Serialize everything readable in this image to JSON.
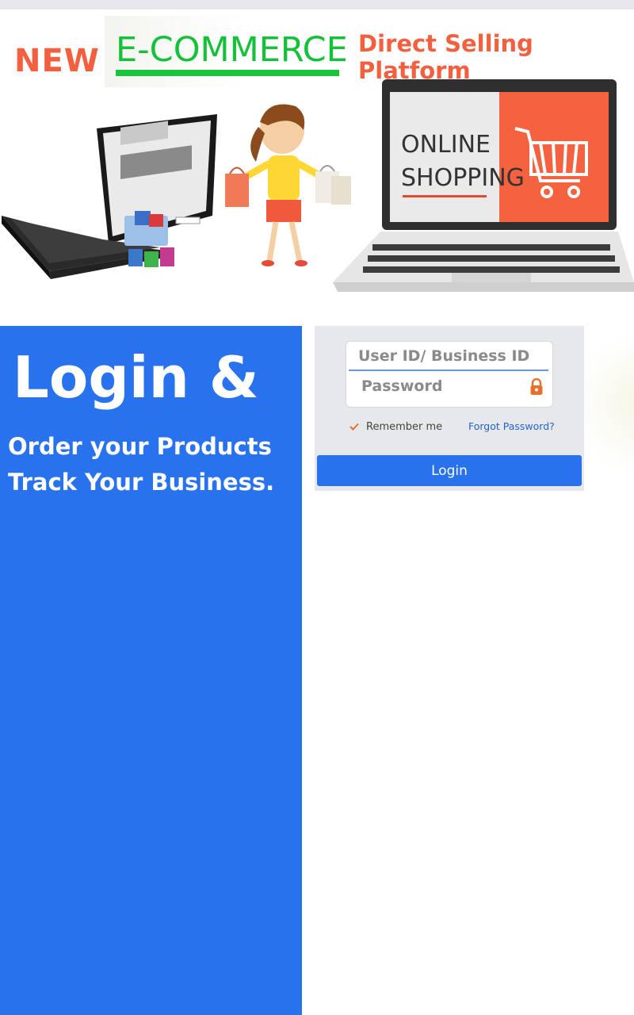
{
  "banner": {
    "new_label": "NEW",
    "ecommerce_label": "E-COMMERCE",
    "direct_selling_label": "Direct Selling Platform",
    "laptop_screen_line1": "ONLINE",
    "laptop_screen_line2": "SHOPPING"
  },
  "hero": {
    "heading": "Login &",
    "line1": "Order your Products",
    "line2": "Track Your Business."
  },
  "login_form": {
    "user_placeholder": "User ID/ Business ID",
    "password_placeholder": "Password",
    "remember_label": "Remember me",
    "forgot_label": "Forgot Password?",
    "login_button": "Login"
  },
  "colors": {
    "accent_blue": "#2872ee",
    "orange": "#f2603f",
    "green": "#16c13a",
    "link_blue": "#2463c9"
  },
  "icons": [
    "lock-icon",
    "checkmark-icon",
    "shopping-cart-icon"
  ]
}
